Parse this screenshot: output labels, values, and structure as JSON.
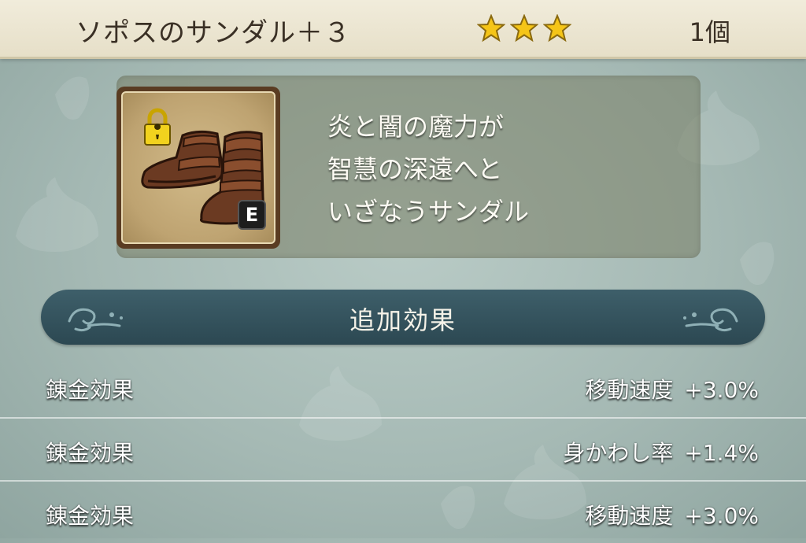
{
  "header": {
    "item_name": "ソポスのサンダル＋３",
    "stars": 3,
    "count": "1個"
  },
  "item": {
    "icon": "leather-sandals-icon",
    "locked": true,
    "equipped_badge": "E",
    "description": [
      "炎と闇の魔力が",
      "智慧の深遠へと",
      "いざなうサンダル"
    ]
  },
  "section": {
    "title": "追加効果"
  },
  "effects": [
    {
      "label": "錬金効果",
      "stat": "移動速度",
      "value": "+3.0%"
    },
    {
      "label": "錬金効果",
      "stat": "身かわし率",
      "value": "+1.4%"
    },
    {
      "label": "錬金効果",
      "stat": "移動速度",
      "value": "+3.0%"
    }
  ],
  "colors": {
    "star": "#f5c518",
    "banner": "#2c4852",
    "background": "#a5b9b4"
  }
}
